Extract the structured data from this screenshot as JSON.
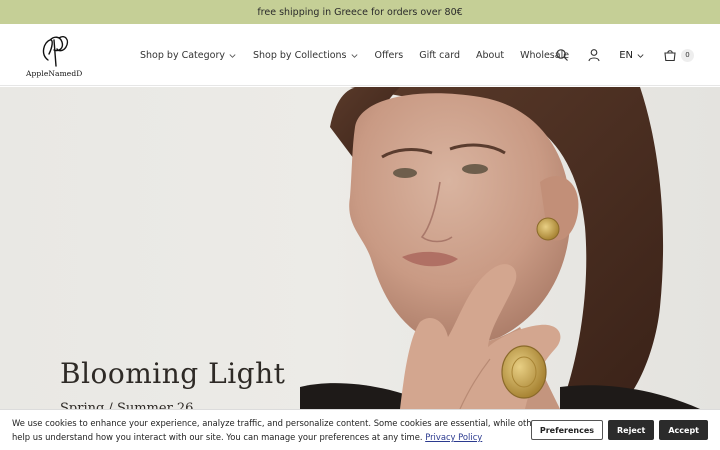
{
  "announcement": "free shipping in Greece for orders over 80€",
  "brand": {
    "name": "AppleNamedD"
  },
  "nav": {
    "items": [
      {
        "label": "Shop by Category",
        "dropdown": true
      },
      {
        "label": "Shop by Collections",
        "dropdown": true
      },
      {
        "label": "Offers",
        "dropdown": false
      },
      {
        "label": "Gift card",
        "dropdown": false
      },
      {
        "label": "About",
        "dropdown": false
      },
      {
        "label": "Wholesale",
        "dropdown": false
      }
    ]
  },
  "header_icons": {
    "search": "search-icon",
    "account": "user-icon",
    "language": "EN",
    "cart_count": "0"
  },
  "hero": {
    "title": "Blooming Light",
    "subtitle": "Spring / Summer 26"
  },
  "cookie": {
    "text": "We use cookies to enhance your experience, analyze traffic, and personalize content. Some cookies are essential, while others help us understand how you interact with our site. You can manage your preferences at any time.",
    "link": "Privacy Policy",
    "preferences": "Preferences",
    "reject": "Reject",
    "accept": "Accept"
  },
  "colors": {
    "announcement_bg": "#c5cf96",
    "button_dark": "#2b2b2b"
  }
}
